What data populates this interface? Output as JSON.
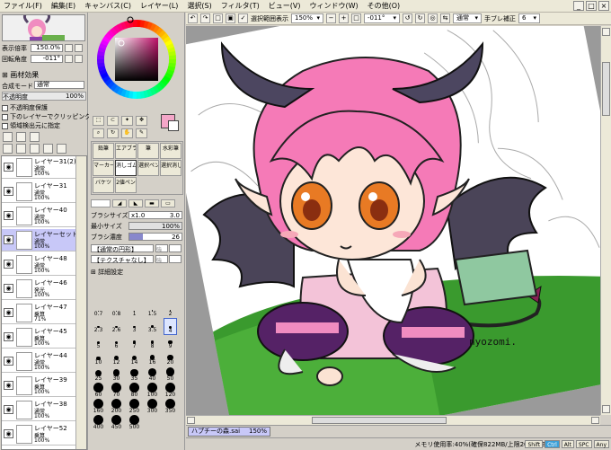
{
  "menu": [
    "ファイル(F)",
    "編集(E)",
    "キャンバス(C)",
    "レイヤー(L)",
    "選択(S)",
    "フィルタ(T)",
    "ビュー(V)",
    "ウィンドウ(W)",
    "その他(O)"
  ],
  "toolbar": {
    "select_view_label": "選択範囲表示",
    "zoom": "150%",
    "rotation": "-011°",
    "mode": "通常",
    "stab_label": "手ブレ補正",
    "stab_value": "6"
  },
  "nav": {
    "zoom_label": "表示倍率",
    "zoom_value": "150.0%",
    "angle_label": "回転角度",
    "angle_value": "-011°"
  },
  "layer_panel": {
    "section_title": "画材効果",
    "blend_label": "合成モード",
    "blend_value": "通常",
    "opacity_label": "不透明度",
    "opacity_value": "100%",
    "protect_label": "不透明度保護",
    "clip_label": "下のレイヤーでクリッピング",
    "select_src_label": "領域検出元に指定",
    "layers": [
      {
        "name": "レイヤー31(2)",
        "mode": "通常",
        "opacity": "100%"
      },
      {
        "name": "レイヤー31",
        "mode": "通常",
        "opacity": "100%"
      },
      {
        "name": "レイヤー40",
        "mode": "通常",
        "opacity": "100%"
      },
      {
        "name": "レイヤーセット6...",
        "mode": "通常",
        "opacity": "100%"
      },
      {
        "name": "レイヤー48",
        "mode": "通常",
        "opacity": "100%"
      },
      {
        "name": "レイヤー46",
        "mode": "発光",
        "opacity": "100%"
      },
      {
        "name": "レイヤー47",
        "mode": "乗算",
        "opacity": "71%"
      },
      {
        "name": "レイヤー45",
        "mode": "乗算",
        "opacity": "100%"
      },
      {
        "name": "レイヤー44",
        "mode": "通常",
        "opacity": "100%"
      },
      {
        "name": "レイヤー39",
        "mode": "乗算",
        "opacity": "100%"
      },
      {
        "name": "レイヤー38",
        "mode": "通常",
        "opacity": "100%"
      },
      {
        "name": "レイヤー52",
        "mode": "乗算",
        "opacity": "100%"
      }
    ]
  },
  "tools": {
    "tabs": [
      "鉛筆",
      "エアブラシ",
      "筆",
      "水彩筆"
    ],
    "row2": [
      "マーカー",
      "消しゴム",
      "選択ペン",
      "選択消し"
    ],
    "row3": [
      "バケツ",
      "2値ペン"
    ],
    "brush_size_label": "ブラシサイズ",
    "brush_size_mult": "x1.0",
    "brush_size_value": "3.0",
    "min_size_label": "最小サイズ",
    "min_size_value": "100%",
    "density_label": "ブラシ濃度",
    "density_value": "26",
    "shape_label": "【通常の円形】",
    "texture_label": "【テクスチャなし】",
    "shape_val": "強",
    "texture_val": "強",
    "detail_label": "詳細設定",
    "sizes": [
      "0.7",
      "0.8",
      "1",
      "1.5",
      "2",
      "2.3",
      "2.6",
      "3",
      "3.5",
      "4",
      "5",
      "6",
      "7",
      "8",
      "9",
      "10",
      "12",
      "14",
      "16",
      "20",
      "25",
      "30",
      "35",
      "40",
      "50",
      "60",
      "70",
      "80",
      "100",
      "120",
      "160",
      "200",
      "250",
      "300",
      "350",
      "400",
      "450",
      "500"
    ]
  },
  "document": {
    "tab_name": "ハプチーの森.sai",
    "tab_zoom": "150%",
    "signature": "nyozomi."
  },
  "status": {
    "memory": "メモリ使用率:40%(確保822MB/上限2047MB)",
    "badges": [
      "Shift",
      "Ctrl",
      "Alt",
      "SPC",
      "Any"
    ]
  },
  "colors": {
    "current_color": "#f4a6c8",
    "background_color": "#ffffff",
    "selected_layer": "#c8c8f8"
  }
}
